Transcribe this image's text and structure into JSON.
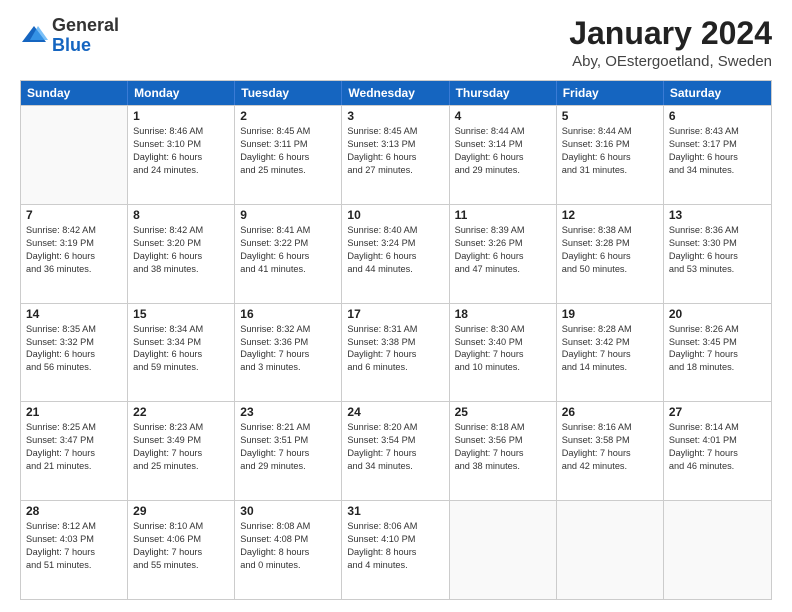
{
  "logo": {
    "general": "General",
    "blue": "Blue"
  },
  "header": {
    "month": "January 2024",
    "location": "Aby, OEstergoetland, Sweden"
  },
  "days": [
    "Sunday",
    "Monday",
    "Tuesday",
    "Wednesday",
    "Thursday",
    "Friday",
    "Saturday"
  ],
  "weeks": [
    [
      {
        "day": "",
        "sunrise": "",
        "sunset": "",
        "daylight": ""
      },
      {
        "day": "1",
        "sunrise": "Sunrise: 8:46 AM",
        "sunset": "Sunset: 3:10 PM",
        "daylight": "Daylight: 6 hours",
        "daylight2": "and 24 minutes."
      },
      {
        "day": "2",
        "sunrise": "Sunrise: 8:45 AM",
        "sunset": "Sunset: 3:11 PM",
        "daylight": "Daylight: 6 hours",
        "daylight2": "and 25 minutes."
      },
      {
        "day": "3",
        "sunrise": "Sunrise: 8:45 AM",
        "sunset": "Sunset: 3:13 PM",
        "daylight": "Daylight: 6 hours",
        "daylight2": "and 27 minutes."
      },
      {
        "day": "4",
        "sunrise": "Sunrise: 8:44 AM",
        "sunset": "Sunset: 3:14 PM",
        "daylight": "Daylight: 6 hours",
        "daylight2": "and 29 minutes."
      },
      {
        "day": "5",
        "sunrise": "Sunrise: 8:44 AM",
        "sunset": "Sunset: 3:16 PM",
        "daylight": "Daylight: 6 hours",
        "daylight2": "and 31 minutes."
      },
      {
        "day": "6",
        "sunrise": "Sunrise: 8:43 AM",
        "sunset": "Sunset: 3:17 PM",
        "daylight": "Daylight: 6 hours",
        "daylight2": "and 34 minutes."
      }
    ],
    [
      {
        "day": "7",
        "sunrise": "Sunrise: 8:42 AM",
        "sunset": "Sunset: 3:19 PM",
        "daylight": "Daylight: 6 hours",
        "daylight2": "and 36 minutes."
      },
      {
        "day": "8",
        "sunrise": "Sunrise: 8:42 AM",
        "sunset": "Sunset: 3:20 PM",
        "daylight": "Daylight: 6 hours",
        "daylight2": "and 38 minutes."
      },
      {
        "day": "9",
        "sunrise": "Sunrise: 8:41 AM",
        "sunset": "Sunset: 3:22 PM",
        "daylight": "Daylight: 6 hours",
        "daylight2": "and 41 minutes."
      },
      {
        "day": "10",
        "sunrise": "Sunrise: 8:40 AM",
        "sunset": "Sunset: 3:24 PM",
        "daylight": "Daylight: 6 hours",
        "daylight2": "and 44 minutes."
      },
      {
        "day": "11",
        "sunrise": "Sunrise: 8:39 AM",
        "sunset": "Sunset: 3:26 PM",
        "daylight": "Daylight: 6 hours",
        "daylight2": "and 47 minutes."
      },
      {
        "day": "12",
        "sunrise": "Sunrise: 8:38 AM",
        "sunset": "Sunset: 3:28 PM",
        "daylight": "Daylight: 6 hours",
        "daylight2": "and 50 minutes."
      },
      {
        "day": "13",
        "sunrise": "Sunrise: 8:36 AM",
        "sunset": "Sunset: 3:30 PM",
        "daylight": "Daylight: 6 hours",
        "daylight2": "and 53 minutes."
      }
    ],
    [
      {
        "day": "14",
        "sunrise": "Sunrise: 8:35 AM",
        "sunset": "Sunset: 3:32 PM",
        "daylight": "Daylight: 6 hours",
        "daylight2": "and 56 minutes."
      },
      {
        "day": "15",
        "sunrise": "Sunrise: 8:34 AM",
        "sunset": "Sunset: 3:34 PM",
        "daylight": "Daylight: 6 hours",
        "daylight2": "and 59 minutes."
      },
      {
        "day": "16",
        "sunrise": "Sunrise: 8:32 AM",
        "sunset": "Sunset: 3:36 PM",
        "daylight": "Daylight: 7 hours",
        "daylight2": "and 3 minutes."
      },
      {
        "day": "17",
        "sunrise": "Sunrise: 8:31 AM",
        "sunset": "Sunset: 3:38 PM",
        "daylight": "Daylight: 7 hours",
        "daylight2": "and 6 minutes."
      },
      {
        "day": "18",
        "sunrise": "Sunrise: 8:30 AM",
        "sunset": "Sunset: 3:40 PM",
        "daylight": "Daylight: 7 hours",
        "daylight2": "and 10 minutes."
      },
      {
        "day": "19",
        "sunrise": "Sunrise: 8:28 AM",
        "sunset": "Sunset: 3:42 PM",
        "daylight": "Daylight: 7 hours",
        "daylight2": "and 14 minutes."
      },
      {
        "day": "20",
        "sunrise": "Sunrise: 8:26 AM",
        "sunset": "Sunset: 3:45 PM",
        "daylight": "Daylight: 7 hours",
        "daylight2": "and 18 minutes."
      }
    ],
    [
      {
        "day": "21",
        "sunrise": "Sunrise: 8:25 AM",
        "sunset": "Sunset: 3:47 PM",
        "daylight": "Daylight: 7 hours",
        "daylight2": "and 21 minutes."
      },
      {
        "day": "22",
        "sunrise": "Sunrise: 8:23 AM",
        "sunset": "Sunset: 3:49 PM",
        "daylight": "Daylight: 7 hours",
        "daylight2": "and 25 minutes."
      },
      {
        "day": "23",
        "sunrise": "Sunrise: 8:21 AM",
        "sunset": "Sunset: 3:51 PM",
        "daylight": "Daylight: 7 hours",
        "daylight2": "and 29 minutes."
      },
      {
        "day": "24",
        "sunrise": "Sunrise: 8:20 AM",
        "sunset": "Sunset: 3:54 PM",
        "daylight": "Daylight: 7 hours",
        "daylight2": "and 34 minutes."
      },
      {
        "day": "25",
        "sunrise": "Sunrise: 8:18 AM",
        "sunset": "Sunset: 3:56 PM",
        "daylight": "Daylight: 7 hours",
        "daylight2": "and 38 minutes."
      },
      {
        "day": "26",
        "sunrise": "Sunrise: 8:16 AM",
        "sunset": "Sunset: 3:58 PM",
        "daylight": "Daylight: 7 hours",
        "daylight2": "and 42 minutes."
      },
      {
        "day": "27",
        "sunrise": "Sunrise: 8:14 AM",
        "sunset": "Sunset: 4:01 PM",
        "daylight": "Daylight: 7 hours",
        "daylight2": "and 46 minutes."
      }
    ],
    [
      {
        "day": "28",
        "sunrise": "Sunrise: 8:12 AM",
        "sunset": "Sunset: 4:03 PM",
        "daylight": "Daylight: 7 hours",
        "daylight2": "and 51 minutes."
      },
      {
        "day": "29",
        "sunrise": "Sunrise: 8:10 AM",
        "sunset": "Sunset: 4:06 PM",
        "daylight": "Daylight: 7 hours",
        "daylight2": "and 55 minutes."
      },
      {
        "day": "30",
        "sunrise": "Sunrise: 8:08 AM",
        "sunset": "Sunset: 4:08 PM",
        "daylight": "Daylight: 8 hours",
        "daylight2": "and 0 minutes."
      },
      {
        "day": "31",
        "sunrise": "Sunrise: 8:06 AM",
        "sunset": "Sunset: 4:10 PM",
        "daylight": "Daylight: 8 hours",
        "daylight2": "and 4 minutes."
      },
      {
        "day": "",
        "sunrise": "",
        "sunset": "",
        "daylight": "",
        "daylight2": ""
      },
      {
        "day": "",
        "sunrise": "",
        "sunset": "",
        "daylight": "",
        "daylight2": ""
      },
      {
        "day": "",
        "sunrise": "",
        "sunset": "",
        "daylight": "",
        "daylight2": ""
      }
    ]
  ]
}
